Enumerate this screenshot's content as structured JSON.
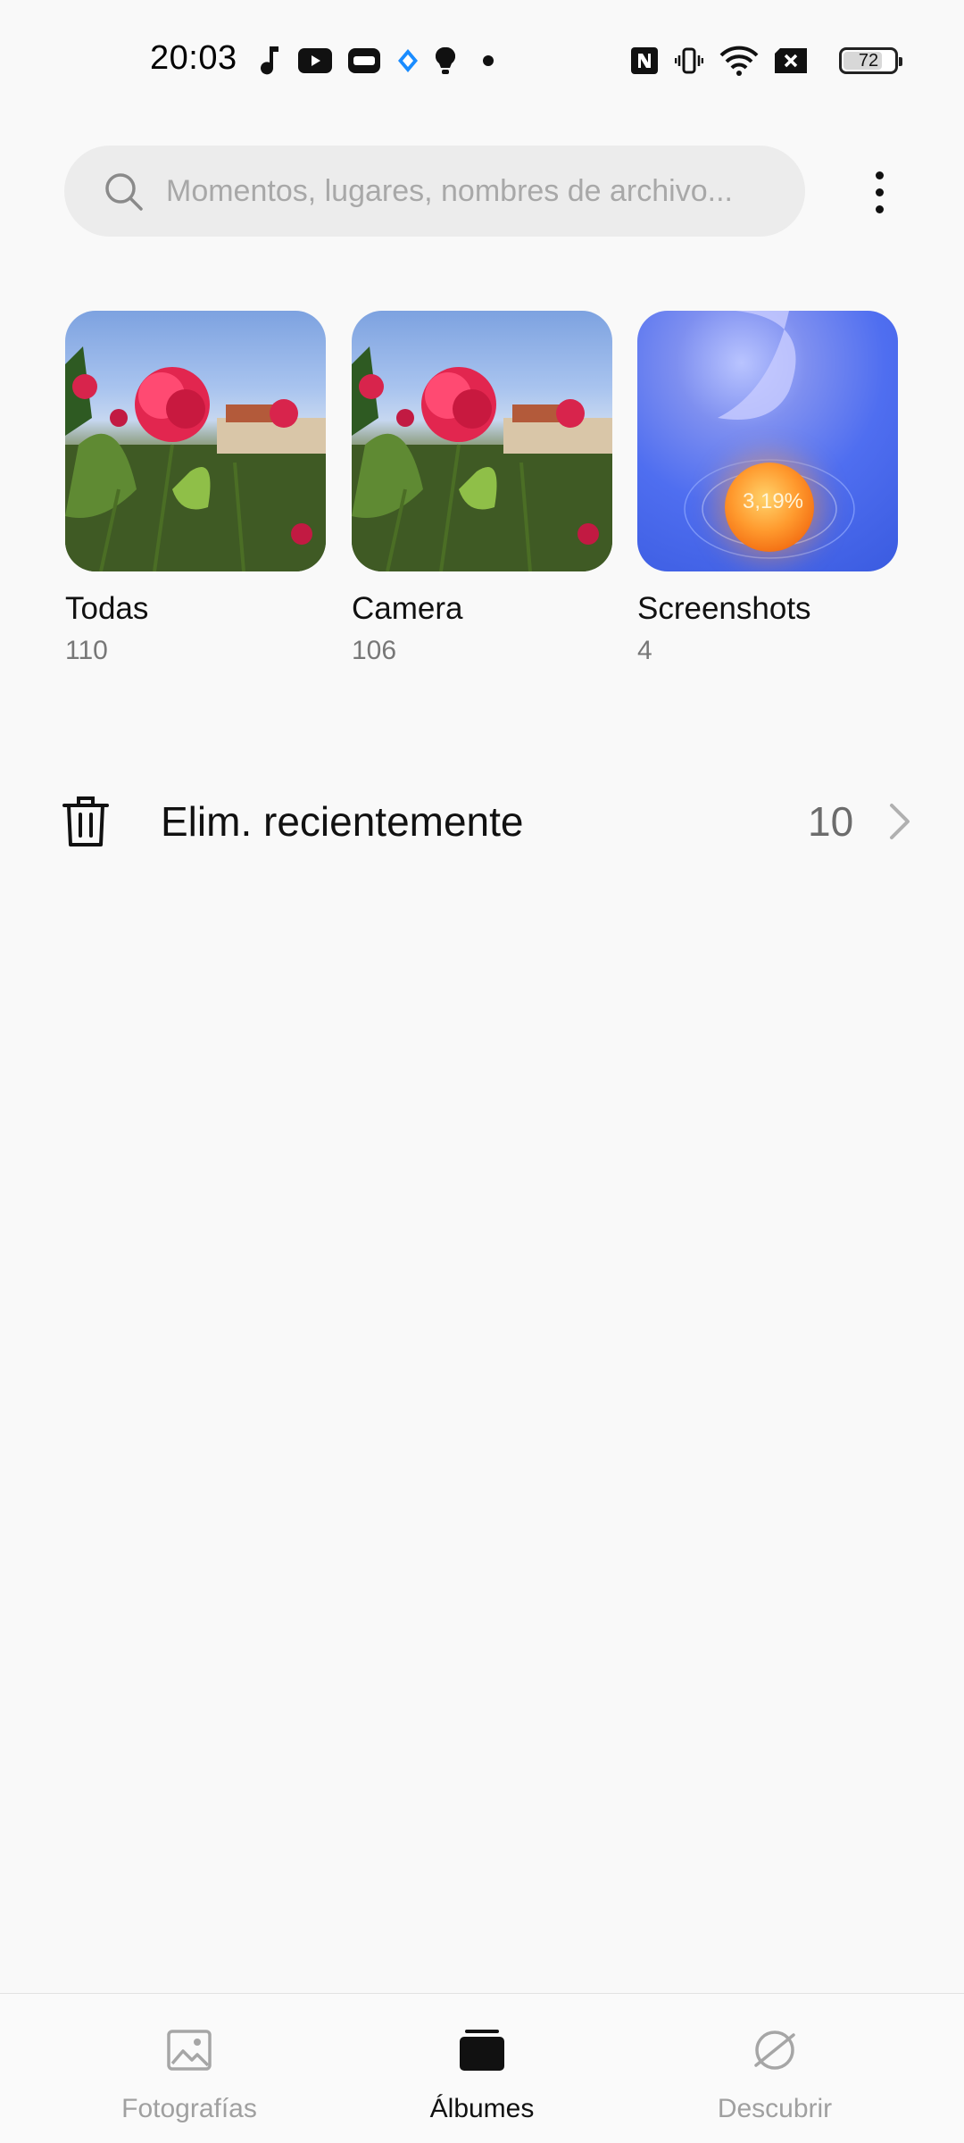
{
  "status_bar": {
    "time": "20:03",
    "battery_level": "72",
    "left_icons": [
      "music-note-icon",
      "youtube-icon",
      "app-icon",
      "app-diamond-icon",
      "lightbulb-icon",
      "dot-icon"
    ],
    "right_icons": [
      "nfc-icon",
      "vibrate-icon",
      "wifi-icon",
      "no-sim-icon",
      "battery-icon"
    ]
  },
  "search": {
    "placeholder": "Momentos, lugares, nombres de archivo..."
  },
  "albums": [
    {
      "name": "Todas",
      "count": "110"
    },
    {
      "name": "Camera",
      "count": "106"
    },
    {
      "name": "Screenshots",
      "count": "4"
    }
  ],
  "screenshot_thumb_text": "3,19%",
  "recently_deleted": {
    "label": "Elim. recientemente",
    "count": "10"
  },
  "bottom_nav": {
    "items": [
      {
        "label": "Fotografías",
        "icon": "image-icon",
        "active": false
      },
      {
        "label": "Álbumes",
        "icon": "album-icon",
        "active": true
      },
      {
        "label": "Descubrir",
        "icon": "planet-icon",
        "active": false
      }
    ]
  },
  "colors": {
    "background": "#f9f9f9",
    "search_bg": "#ececec",
    "text_primary": "#111111",
    "text_secondary": "#777777",
    "nav_inactive": "#a0a0a0"
  }
}
